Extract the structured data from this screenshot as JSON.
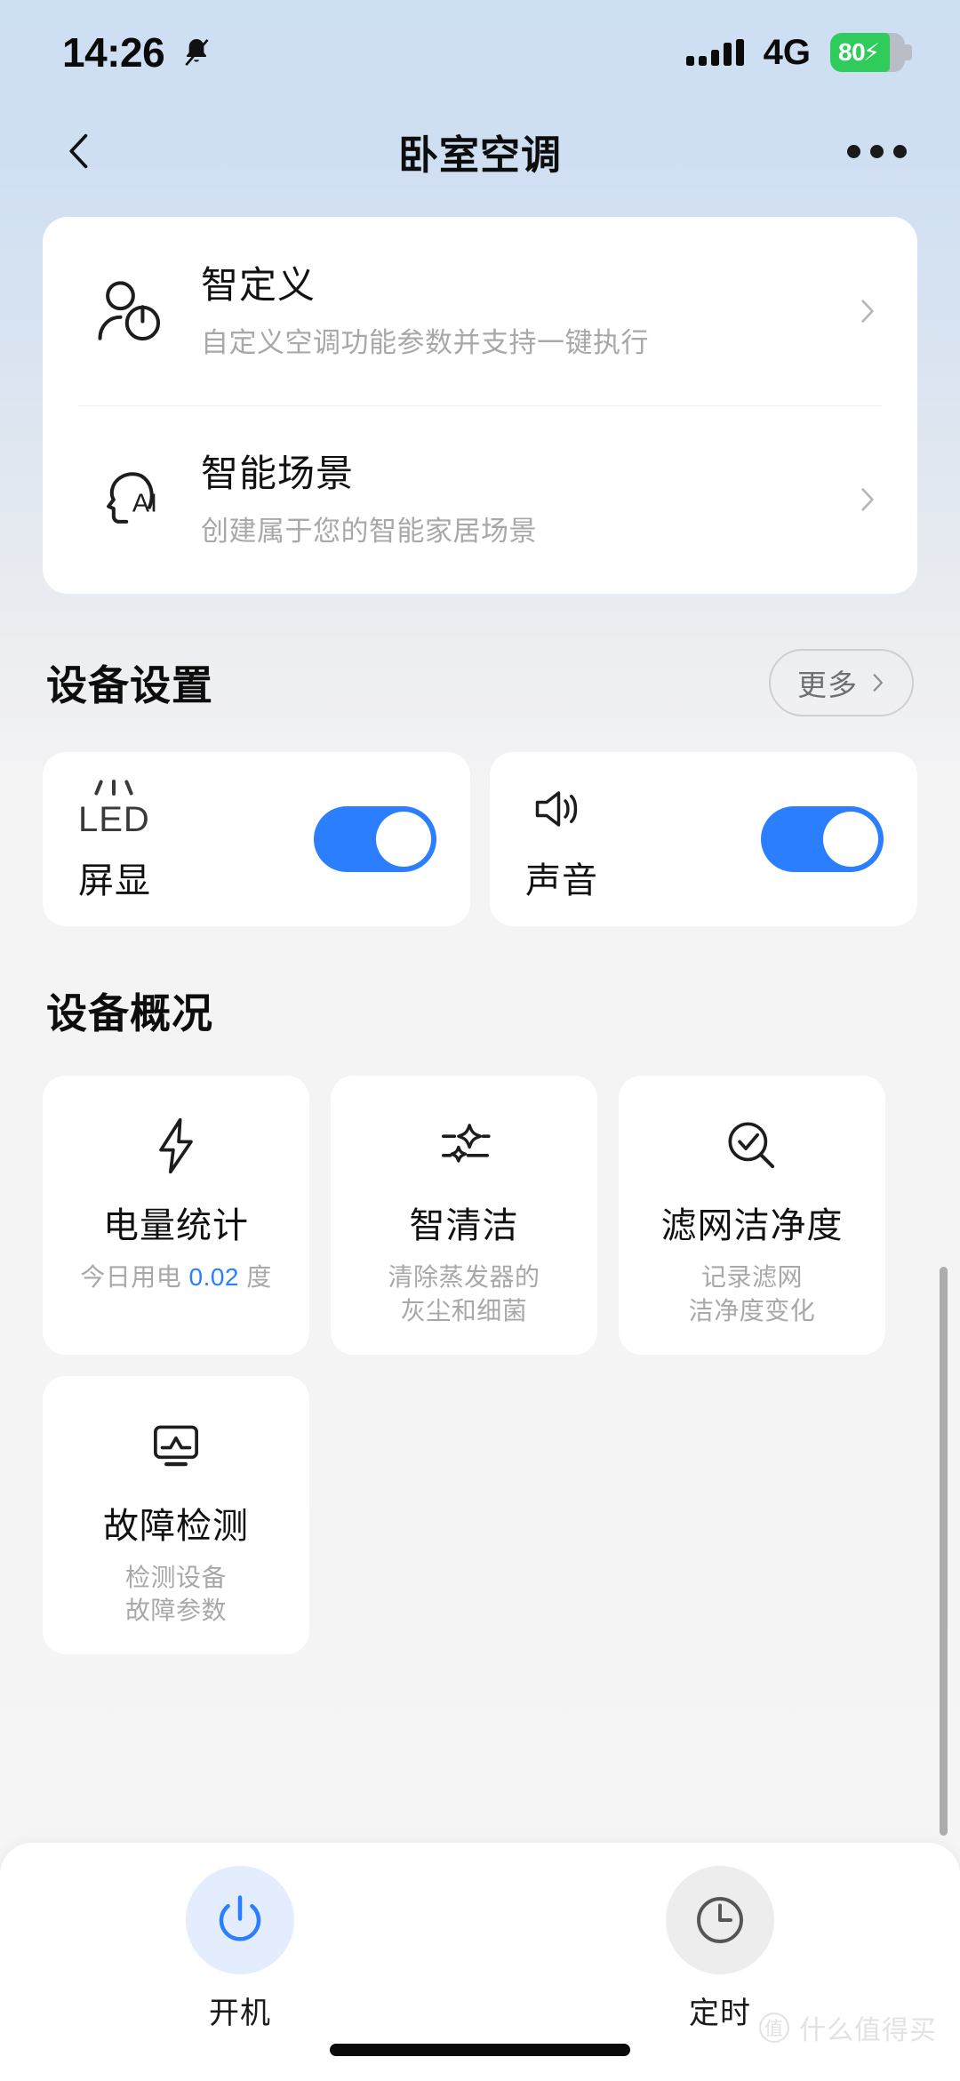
{
  "statusbar": {
    "time": "14:26",
    "mute_icon": "bell-muted-icon",
    "signal_icon": "signal-bars-icon",
    "network": "4G",
    "battery_level": "80",
    "battery_percent": 80,
    "charging_icon": "lightning-bolt-icon",
    "battery_color": "#2fcb5b"
  },
  "navbar": {
    "back_icon": "chevron-left-icon",
    "title": "卧室空调",
    "more_icon": "more-horizontal-icon"
  },
  "top_card": {
    "rows": [
      {
        "icon": "person-power-icon",
        "title": "智定义",
        "subtitle": "自定义空调功能参数并支持一键执行",
        "chevron": "chevron-right-icon"
      },
      {
        "icon": "ai-head-icon",
        "title": "智能场景",
        "subtitle": "创建属于您的智能家居场景",
        "chevron": "chevron-right-icon"
      }
    ]
  },
  "device_settings": {
    "heading": "设备设置",
    "more_label": "更多",
    "more_chevron": "chevron-right-icon",
    "toggles": [
      {
        "icon": "led-display-icon",
        "icon_text": "LED",
        "label": "屏显",
        "state": "on"
      },
      {
        "icon": "speaker-sound-icon",
        "label": "声音",
        "state": "on"
      }
    ],
    "accent_color": "#2b7fff"
  },
  "device_overview": {
    "heading": "设备概况",
    "cards": [
      {
        "icon": "lightning-bolt-icon",
        "title": "电量统计",
        "sub_prefix": "今日用电 ",
        "sub_value": "0.02",
        "sub_suffix": " 度",
        "value_color": "#2b7fff"
      },
      {
        "icon": "sparkle-clean-icon",
        "title": "智清洁",
        "sub_line1": "清除蒸发器的",
        "sub_line2": "灰尘和细菌"
      },
      {
        "icon": "magnifier-check-icon",
        "title": "滤网洁净度",
        "sub_line1": "记录滤网",
        "sub_line2": "洁净度变化"
      },
      {
        "icon": "monitor-waveform-icon",
        "title": "故障检测",
        "sub_line1": "检测设备",
        "sub_line2": "故障参数"
      }
    ]
  },
  "bottom_bar": {
    "items": [
      {
        "icon": "power-icon",
        "label": "开机",
        "state": "active",
        "color": "#2b7fff"
      },
      {
        "icon": "clock-icon",
        "label": "定时",
        "state": "inactive",
        "color": "#555555"
      }
    ]
  },
  "watermark": {
    "logo": "值",
    "text": "什么值得买"
  }
}
